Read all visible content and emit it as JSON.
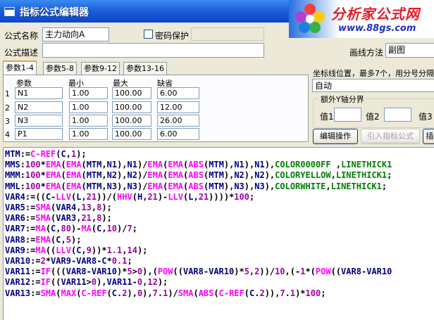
{
  "window": {
    "title": "指标公式编辑器"
  },
  "brand": {
    "name": "分析家公式网",
    "url": "www.88gs.com"
  },
  "form": {
    "name_label": "公式名称",
    "name_value": "主力动向A",
    "password_label": "密码保护",
    "desc_label": "公式描述",
    "desc_value": "",
    "draw_method_label": "画线方法",
    "draw_method_value": "副图"
  },
  "tabs": [
    "参数1-4",
    "参数5-8",
    "参数9-12",
    "参数13-16"
  ],
  "params": {
    "headers": [
      "参数",
      "最小",
      "最大",
      "缺省"
    ],
    "rows": [
      {
        "idx": "1",
        "name": "N1",
        "min": "1.00",
        "max": "100.00",
        "def": "6.00"
      },
      {
        "idx": "2",
        "name": "N2",
        "min": "1.00",
        "max": "100.00",
        "def": "12.00"
      },
      {
        "idx": "3",
        "name": "N3",
        "min": "1.00",
        "max": "100.00",
        "def": "26.00"
      },
      {
        "idx": "4",
        "name": "P1",
        "min": "1.00",
        "max": "100.00",
        "def": "6.00"
      }
    ]
  },
  "axis": {
    "label": "坐标线位置，最多7个，用分号分隔",
    "value": "自动",
    "extra_label": "额外Y轴分界",
    "v1": "值1",
    "v2": "值2",
    "v3": "值3"
  },
  "buttons": {
    "edit": "编辑操作",
    "import": "引入指标公式",
    "insert": "插"
  },
  "colors": {
    "keyword": "#0000cc",
    "function": "#ff00ff",
    "number": "#a000a0",
    "color_const": "#008000"
  },
  "code": [
    [
      [
        "v",
        "MTM"
      ],
      [
        "p",
        ":="
      ],
      [
        "f",
        "C-REF"
      ],
      [
        "p",
        "("
      ],
      [
        "v",
        "C"
      ],
      [
        "p",
        ","
      ],
      [
        "n",
        "1"
      ],
      [
        "p",
        ");"
      ]
    ],
    [
      [
        "v",
        "MMS"
      ],
      [
        "p",
        ":"
      ],
      [
        "n",
        "100"
      ],
      [
        "p",
        "*"
      ],
      [
        "f",
        "EMA"
      ],
      [
        "p",
        "("
      ],
      [
        "f",
        "EMA"
      ],
      [
        "p",
        "("
      ],
      [
        "v",
        "MTM"
      ],
      [
        "p",
        ","
      ],
      [
        "v",
        "N1"
      ],
      [
        "p",
        "),"
      ],
      [
        "v",
        "N1"
      ],
      [
        "p",
        ")/"
      ],
      [
        "f",
        "EMA"
      ],
      [
        "p",
        "("
      ],
      [
        "f",
        "EMA"
      ],
      [
        "p",
        "("
      ],
      [
        "f",
        "ABS"
      ],
      [
        "p",
        "("
      ],
      [
        "v",
        "MTM"
      ],
      [
        "p",
        "),"
      ],
      [
        "v",
        "N1"
      ],
      [
        "p",
        "),"
      ],
      [
        "v",
        "N1"
      ],
      [
        "p",
        "),"
      ],
      [
        "c",
        "COLOR0000FF"
      ],
      [
        "p",
        " ,"
      ],
      [
        "c",
        "LINETHICK1"
      ]
    ],
    [
      [
        "v",
        "MMM"
      ],
      [
        "p",
        ":"
      ],
      [
        "n",
        "100"
      ],
      [
        "p",
        "*"
      ],
      [
        "f",
        "EMA"
      ],
      [
        "p",
        "("
      ],
      [
        "f",
        "EMA"
      ],
      [
        "p",
        "("
      ],
      [
        "v",
        "MTM"
      ],
      [
        "p",
        ","
      ],
      [
        "v",
        "N2"
      ],
      [
        "p",
        "),"
      ],
      [
        "v",
        "N2"
      ],
      [
        "p",
        ")/"
      ],
      [
        "f",
        "EMA"
      ],
      [
        "p",
        "("
      ],
      [
        "f",
        "EMA"
      ],
      [
        "p",
        "("
      ],
      [
        "f",
        "ABS"
      ],
      [
        "p",
        "("
      ],
      [
        "v",
        "MTM"
      ],
      [
        "p",
        "),"
      ],
      [
        "v",
        "N2"
      ],
      [
        "p",
        "),"
      ],
      [
        "v",
        "N2"
      ],
      [
        "p",
        "),"
      ],
      [
        "c",
        "COLORYELLOW"
      ],
      [
        "p",
        ","
      ],
      [
        "c",
        "LINETHICK1"
      ],
      [
        "p",
        ";"
      ]
    ],
    [
      [
        "v",
        "MML"
      ],
      [
        "p",
        ":"
      ],
      [
        "n",
        "100"
      ],
      [
        "p",
        "*"
      ],
      [
        "f",
        "EMA"
      ],
      [
        "p",
        "("
      ],
      [
        "f",
        "EMA"
      ],
      [
        "p",
        "("
      ],
      [
        "v",
        "MTM"
      ],
      [
        "p",
        ","
      ],
      [
        "v",
        "N3"
      ],
      [
        "p",
        "),"
      ],
      [
        "v",
        "N3"
      ],
      [
        "p",
        ")/"
      ],
      [
        "f",
        "EMA"
      ],
      [
        "p",
        "("
      ],
      [
        "f",
        "EMA"
      ],
      [
        "p",
        "("
      ],
      [
        "f",
        "ABS"
      ],
      [
        "p",
        "("
      ],
      [
        "v",
        "MTM"
      ],
      [
        "p",
        "),"
      ],
      [
        "v",
        "N3"
      ],
      [
        "p",
        "),"
      ],
      [
        "v",
        "N3"
      ],
      [
        "p",
        "),"
      ],
      [
        "c",
        "COLORWHITE"
      ],
      [
        "p",
        ","
      ],
      [
        "c",
        "LINETHICK1"
      ],
      [
        "p",
        "; "
      ]
    ],
    [
      [
        "v",
        "VAR4"
      ],
      [
        "p",
        ":=(("
      ],
      [
        "v",
        "C"
      ],
      [
        "p",
        "-"
      ],
      [
        "f",
        "LLV"
      ],
      [
        "p",
        "("
      ],
      [
        "v",
        "L"
      ],
      [
        "p",
        ","
      ],
      [
        "n",
        "21"
      ],
      [
        "p",
        "))/("
      ],
      [
        "f",
        "HHV"
      ],
      [
        "p",
        "("
      ],
      [
        "v",
        "H"
      ],
      [
        "p",
        ","
      ],
      [
        "n",
        "21"
      ],
      [
        "p",
        ")-"
      ],
      [
        "f",
        "LLV"
      ],
      [
        "p",
        "("
      ],
      [
        "v",
        "L"
      ],
      [
        "p",
        ","
      ],
      [
        "n",
        "21"
      ],
      [
        "p",
        "))))*"
      ],
      [
        "n",
        "100"
      ],
      [
        "p",
        ";"
      ]
    ],
    [
      [
        "v",
        "VAR5"
      ],
      [
        "p",
        ":="
      ],
      [
        "f",
        "SMA"
      ],
      [
        "p",
        "("
      ],
      [
        "v",
        "VAR4"
      ],
      [
        "p",
        ","
      ],
      [
        "n",
        "13"
      ],
      [
        "p",
        ","
      ],
      [
        "n",
        "8"
      ],
      [
        "p",
        ");"
      ]
    ],
    [
      [
        "v",
        "VAR6"
      ],
      [
        "p",
        ":="
      ],
      [
        "f",
        "SMA"
      ],
      [
        "p",
        "("
      ],
      [
        "v",
        "VAR3"
      ],
      [
        "p",
        ","
      ],
      [
        "n",
        "21"
      ],
      [
        "p",
        ","
      ],
      [
        "n",
        "8"
      ],
      [
        "p",
        ");"
      ]
    ],
    [
      [
        "v",
        "VAR7"
      ],
      [
        "p",
        ":="
      ],
      [
        "f",
        "MA"
      ],
      [
        "p",
        "("
      ],
      [
        "v",
        "C"
      ],
      [
        "p",
        ","
      ],
      [
        "n",
        "80"
      ],
      [
        "p",
        ")-"
      ],
      [
        "f",
        "MA"
      ],
      [
        "p",
        "("
      ],
      [
        "v",
        "C"
      ],
      [
        "p",
        ","
      ],
      [
        "n",
        "10"
      ],
      [
        "p",
        ")/"
      ],
      [
        "n",
        "7"
      ],
      [
        "p",
        ";"
      ]
    ],
    [
      [
        "v",
        "VAR8"
      ],
      [
        "p",
        ":="
      ],
      [
        "f",
        "EMA"
      ],
      [
        "p",
        "("
      ],
      [
        "v",
        "C"
      ],
      [
        "p",
        ","
      ],
      [
        "n",
        "5"
      ],
      [
        "p",
        ");"
      ]
    ],
    [
      [
        "v",
        "VAR9"
      ],
      [
        "p",
        ":="
      ],
      [
        "f",
        "MA"
      ],
      [
        "p",
        "(("
      ],
      [
        "f",
        "LLV"
      ],
      [
        "p",
        "("
      ],
      [
        "v",
        "C"
      ],
      [
        "p",
        ","
      ],
      [
        "n",
        "9"
      ],
      [
        "p",
        "))*"
      ],
      [
        "n",
        "1.1"
      ],
      [
        "p",
        ","
      ],
      [
        "n",
        "14"
      ],
      [
        "p",
        ");"
      ]
    ],
    [
      [
        "v",
        "VAR10"
      ],
      [
        "p",
        ":="
      ],
      [
        "n",
        "2"
      ],
      [
        "p",
        "*"
      ],
      [
        "v",
        "VAR9"
      ],
      [
        "p",
        "-"
      ],
      [
        "v",
        "VAR8"
      ],
      [
        "p",
        "-"
      ],
      [
        "v",
        "C"
      ],
      [
        "p",
        "*"
      ],
      [
        "n",
        "0.1"
      ],
      [
        "p",
        ";"
      ]
    ],
    [
      [
        "v",
        "VAR11"
      ],
      [
        "p",
        ":="
      ],
      [
        "f",
        "IF"
      ],
      [
        "p",
        "((("
      ],
      [
        "v",
        "VAR8"
      ],
      [
        "p",
        "-"
      ],
      [
        "v",
        "VAR10"
      ],
      [
        "p",
        ")*"
      ],
      [
        "n",
        "5"
      ],
      [
        "p",
        ">"
      ],
      [
        "n",
        "0"
      ],
      [
        "p",
        "),("
      ],
      [
        "f",
        "POW"
      ],
      [
        "p",
        "(("
      ],
      [
        "v",
        "VAR8"
      ],
      [
        "p",
        "-"
      ],
      [
        "v",
        "VAR10"
      ],
      [
        "p",
        ")*"
      ],
      [
        "n",
        "5"
      ],
      [
        "p",
        ","
      ],
      [
        "n",
        "2"
      ],
      [
        "p",
        "))/"
      ],
      [
        "n",
        "10"
      ],
      [
        "p",
        ",(-"
      ],
      [
        "n",
        "1"
      ],
      [
        "p",
        "*("
      ],
      [
        "f",
        "POW"
      ],
      [
        "p",
        "(("
      ],
      [
        "v",
        "VAR8"
      ],
      [
        "p",
        "-"
      ],
      [
        "v",
        "VAR10"
      ]
    ],
    [
      [
        "v",
        "VAR12"
      ],
      [
        "p",
        ":="
      ],
      [
        "f",
        "IF"
      ],
      [
        "p",
        "(("
      ],
      [
        "v",
        "VAR11"
      ],
      [
        "p",
        ">"
      ],
      [
        "n",
        "0"
      ],
      [
        "p",
        "),"
      ],
      [
        "v",
        "VAR11"
      ],
      [
        "p",
        "-"
      ],
      [
        "n",
        "0"
      ],
      [
        "p",
        ","
      ],
      [
        "n",
        "12"
      ],
      [
        "p",
        ");"
      ]
    ],
    [
      [
        "v",
        "VAR13"
      ],
      [
        "p",
        ":="
      ],
      [
        "f",
        "SMA"
      ],
      [
        "p",
        "("
      ],
      [
        "f",
        "MAX"
      ],
      [
        "p",
        "("
      ],
      [
        "f",
        "C-REF"
      ],
      [
        "p",
        "("
      ],
      [
        "v",
        "C"
      ],
      [
        "p",
        "."
      ],
      [
        "n",
        "2"
      ],
      [
        "p",
        "),"
      ],
      [
        "n",
        "0"
      ],
      [
        "p",
        "),"
      ],
      [
        "n",
        "7"
      ],
      [
        "p",
        "."
      ],
      [
        "n",
        "1"
      ],
      [
        "p",
        ")/"
      ],
      [
        "f",
        "SMA"
      ],
      [
        "p",
        "("
      ],
      [
        "f",
        "ABS"
      ],
      [
        "p",
        "("
      ],
      [
        "f",
        "C-REF"
      ],
      [
        "p",
        "("
      ],
      [
        "v",
        "C"
      ],
      [
        "p",
        "."
      ],
      [
        "n",
        "2"
      ],
      [
        "p",
        ")),"
      ],
      [
        "n",
        "7"
      ],
      [
        "p",
        "."
      ],
      [
        "n",
        "1"
      ],
      [
        "p",
        ")*"
      ],
      [
        "n",
        "100"
      ],
      [
        "p",
        ";"
      ]
    ]
  ]
}
